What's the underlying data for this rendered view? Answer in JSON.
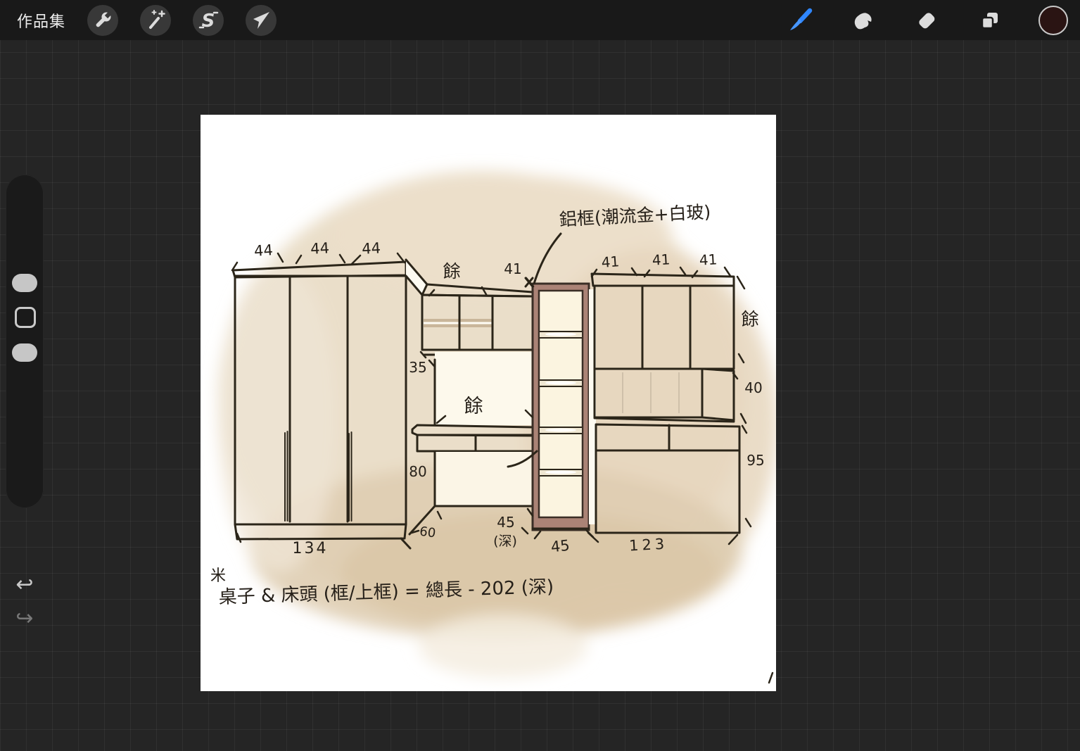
{
  "top_bar": {
    "gallery_label": "作品集",
    "left_icons": [
      "wrench-actions",
      "adjustments-wand",
      "selection",
      "transform-move"
    ],
    "selection_glyph": "S",
    "right_icons": [
      "paint-brush",
      "smudge",
      "eraser",
      "layers",
      "color-swatch"
    ],
    "active_tool": "paint-brush",
    "accent_color": "#2f86ff",
    "swatch_color": "#2a1413"
  },
  "sidebar": {
    "controls": [
      "brush-size-slider",
      "modify-button",
      "opacity-slider",
      "undo-button",
      "redo-button"
    ],
    "undo_glyph": "↩",
    "redo_glyph": "↪"
  },
  "canvas": {
    "paper_color": "#ffffff",
    "wash_color": "#e9dcc6",
    "ink_color": "#2b2519",
    "wood_color": "#d9cbb8",
    "frame_color": "#ab8376",
    "sketch": {
      "note_top": "鋁框(潮流金+白玻)",
      "leftover": "餘",
      "dims_top_left": [
        "44",
        "44",
        "44"
      ],
      "dim_top_mid": "41",
      "dims_top_right": [
        "41",
        "41",
        "41"
      ],
      "dim_35": "35",
      "dim_80": "80",
      "dim_60": "60",
      "dim_134": "134",
      "dim_40": "40",
      "dim_95": "95",
      "dim_45_depth": "45",
      "depth_suffix": "(深)",
      "dim_45": "45",
      "dim_123": "123",
      "footnote_mark": "米",
      "footnote": "桌子 & 床頭 (框/上框) = 總長 - 202 (深)"
    }
  }
}
